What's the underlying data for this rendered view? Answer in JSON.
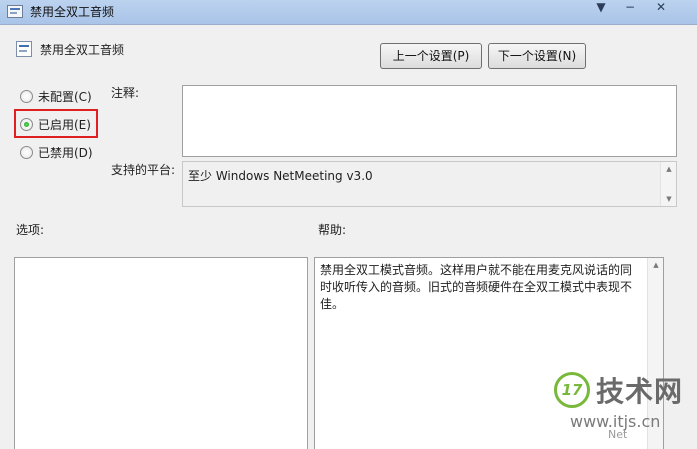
{
  "window": {
    "title": "禁用全双工音频",
    "controls": {
      "dropdown": "▼",
      "minimize": "−",
      "close": "✕"
    }
  },
  "header": {
    "title": "禁用全双工音频",
    "prev_label": "上一个设置(P)",
    "next_label": "下一个设置(N)"
  },
  "options": [
    {
      "label": "未配置(C)",
      "selected": false
    },
    {
      "label": "已启用(E)",
      "selected": true
    },
    {
      "label": "已禁用(D)",
      "selected": false
    }
  ],
  "comment": {
    "label": "注释:",
    "value": ""
  },
  "platform": {
    "label": "支持的平台:",
    "value": "至少 Windows NetMeeting v3.0"
  },
  "options_pane": {
    "label": "选项:"
  },
  "help_pane": {
    "label": "帮助:",
    "text": "禁用全双工模式音频。这样用户就不能在用麦克风说话的同时收听传入的音频。旧式的音频硬件在全双工模式中表现不佳。"
  },
  "watermark": {
    "logo": "17",
    "name": "技术网",
    "url": "www.itjs.cn",
    "small": "Net"
  }
}
